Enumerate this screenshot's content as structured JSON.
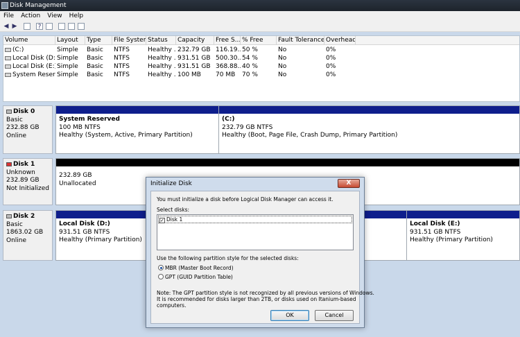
{
  "window": {
    "title": "Disk Management"
  },
  "menu": [
    "File",
    "Action",
    "View",
    "Help"
  ],
  "toolbar": [
    "back-icon",
    "forward-icon",
    "console-icon",
    "properties-icon",
    "help-icon",
    "refresh-icon",
    "export-icon",
    "view-icon"
  ],
  "volume_list": {
    "columns": [
      "Volume",
      "Layout",
      "Type",
      "File System",
      "Status",
      "Capacity",
      "Free S...",
      "% Free",
      "Fault Tolerance",
      "Overhead"
    ],
    "rows": [
      [
        "(C:)",
        "Simple",
        "Basic",
        "NTFS",
        "Healthy ...",
        "232.79 GB",
        "116.19...",
        "50 %",
        "No",
        "0%"
      ],
      [
        "Local Disk (D:)",
        "Simple",
        "Basic",
        "NTFS",
        "Healthy ...",
        "931.51 GB",
        "500.30...",
        "54 %",
        "No",
        "0%"
      ],
      [
        "Local Disk (E:)",
        "Simple",
        "Basic",
        "NTFS",
        "Healthy ...",
        "931.51 GB",
        "368.88...",
        "40 %",
        "No",
        "0%"
      ],
      [
        "System Reserv...",
        "Simple",
        "Basic",
        "NTFS",
        "Healthy ...",
        "100 MB",
        "70 MB",
        "70 %",
        "No",
        "0%"
      ]
    ]
  },
  "disks": [
    {
      "name": "Disk 0",
      "type": "Basic",
      "size": "232.88 GB",
      "status": "Online",
      "partitions": [
        {
          "name": "System Reserved",
          "size": "100 MB NTFS",
          "status": "Healthy (System, Active, Primary Partition)"
        },
        {
          "name": "(C:)",
          "size": "232.79 GB NTFS",
          "status": "Healthy (Boot, Page File, Crash Dump, Primary Partition)"
        }
      ]
    },
    {
      "name": "Disk 1",
      "type": "Unknown",
      "size": "232.89 GB",
      "status": "Not Initialized",
      "partitions": [
        {
          "name": "",
          "size": "232.89 GB",
          "status": "Unallocated"
        }
      ]
    },
    {
      "name": "Disk 2",
      "type": "Basic",
      "size": "1863.02 GB",
      "status": "Online",
      "partitions": [
        {
          "name": "Local Disk  (D:)",
          "size": "931.51 GB NTFS",
          "status": "Healthy (Primary Partition)"
        },
        {
          "name": "Local Disk  (E:)",
          "size": "931.51 GB NTFS",
          "status": "Healthy (Primary Partition)"
        }
      ]
    }
  ],
  "dialog": {
    "title": "Initialize Disk",
    "close": "X",
    "intro": "You must initialize a disk before Logical Disk Manager can access it.",
    "select_label": "Select disks:",
    "disk_item": "Disk 1",
    "style_label": "Use the following partition style for the selected disks:",
    "mbr": "MBR (Master Boot Record)",
    "gpt": "GPT (GUID Partition Table)",
    "note": [
      "Note: The GPT partition style is not recognized by all previous versions of Windows.",
      "It is recommended for disks larger than 2TB, or disks used on Itanium-based",
      "computers."
    ],
    "ok": "OK",
    "cancel": "Cancel"
  }
}
